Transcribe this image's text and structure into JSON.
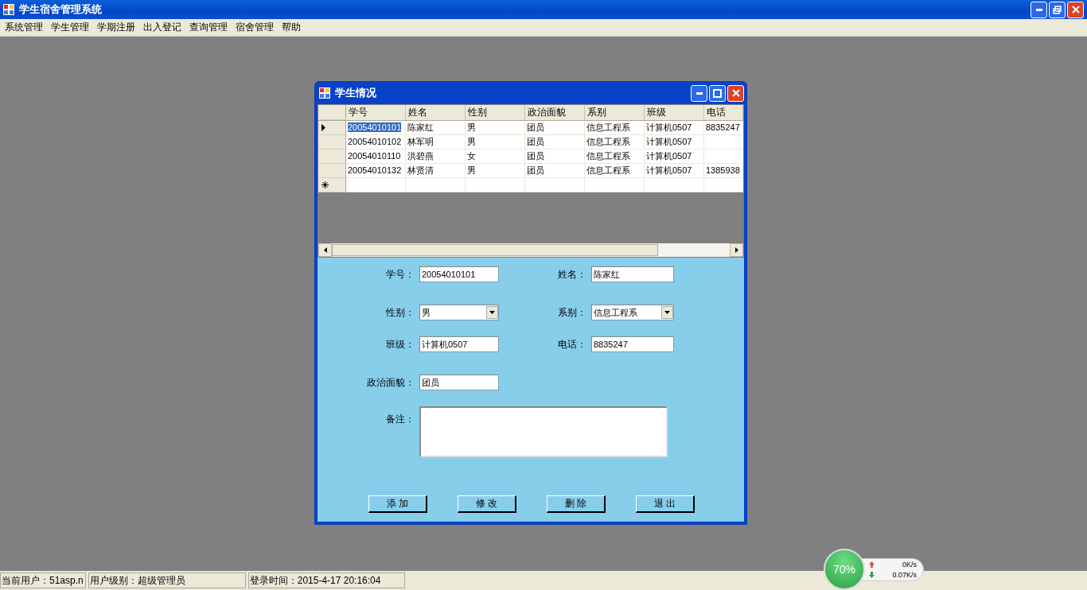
{
  "window": {
    "title": "学生宿舍管理系统"
  },
  "menu": [
    "系统管理",
    "学生管理",
    "学期注册",
    "出入登记",
    "查询管理",
    "宿舍管理",
    "帮助"
  ],
  "child_window": {
    "title": "学生情况",
    "table": {
      "columns": [
        "学号",
        "姓名",
        "性别",
        "政治面貌",
        "系别",
        "班级",
        "电话"
      ],
      "rows": [
        {
          "selected": true,
          "cells": [
            "20054010101",
            "陈家红",
            "男",
            "团员",
            "信息工程系",
            "计算机0507",
            "8835247"
          ]
        },
        {
          "selected": false,
          "cells": [
            "20054010102",
            "林军明",
            "男",
            "团员",
            "信息工程系",
            "计算机0507",
            ""
          ]
        },
        {
          "selected": false,
          "cells": [
            "20054010110",
            "洪碧燕",
            "女",
            "团员",
            "信息工程系",
            "计算机0507",
            ""
          ]
        },
        {
          "selected": false,
          "cells": [
            "20054010132",
            "林贤清",
            "男",
            "团员",
            "信息工程系",
            "计算机0507",
            "1385938"
          ]
        }
      ]
    },
    "form": [
      {
        "label": "学号：",
        "kind": "text",
        "value": "20054010101"
      },
      {
        "label": "姓名：",
        "kind": "text",
        "value": "陈家红"
      },
      {
        "label": "性别：",
        "kind": "select",
        "value": "男"
      },
      {
        "label": "系别：",
        "kind": "select",
        "value": "信息工程系"
      },
      {
        "label": "班级：",
        "kind": "text",
        "value": "计算机0507"
      },
      {
        "label": "电话：",
        "kind": "text",
        "value": "8835247"
      },
      {
        "label": "政治面貌：",
        "kind": "text",
        "value": "团员"
      },
      {
        "label": "备注：",
        "kind": "memo"
      }
    ],
    "buttons": [
      "添 加",
      "修 改",
      "删 除",
      "退 出"
    ]
  },
  "status_bar": [
    "当前用户：51asp.n",
    "用户级别：超级管理员",
    "登录时间：2015-4-17 20:16:04"
  ],
  "net_widget": {
    "percent": "70%",
    "upload": "0K/s",
    "download": "0.07K/s"
  }
}
